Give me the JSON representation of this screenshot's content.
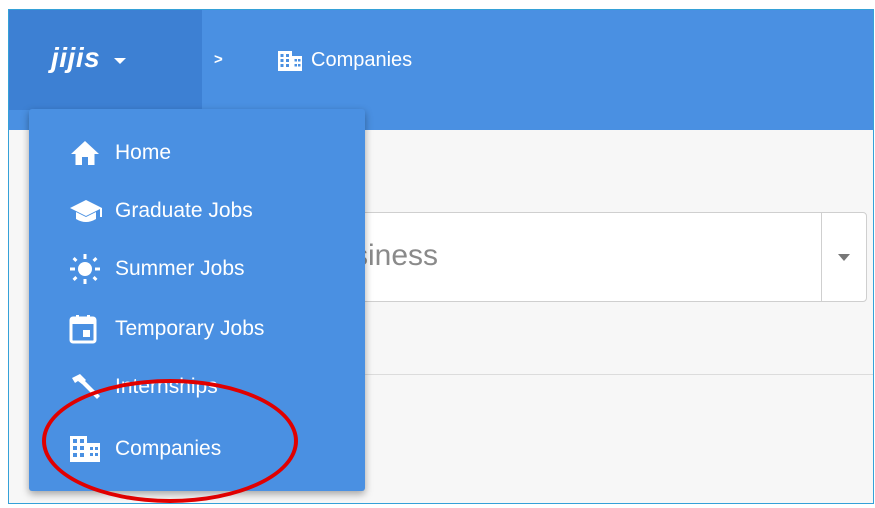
{
  "brand": {
    "name": "jijis"
  },
  "breadcrumb": {
    "separator": ">",
    "current": "Companies"
  },
  "search": {
    "value_partial": "siness"
  },
  "menu": {
    "items": [
      {
        "label": "Home",
        "icon": "home-icon"
      },
      {
        "label": "Graduate Jobs",
        "icon": "graduation-cap-icon"
      },
      {
        "label": "Summer Jobs",
        "icon": "sun-icon"
      },
      {
        "label": "Temporary Jobs",
        "icon": "calendar-icon"
      },
      {
        "label": "Internships",
        "icon": "hammer-icon"
      },
      {
        "label": "Companies",
        "icon": "building-icon"
      }
    ]
  },
  "colors": {
    "header": "#4a90e2",
    "brand_bg": "#3d80d3",
    "highlight": "#e00000"
  }
}
